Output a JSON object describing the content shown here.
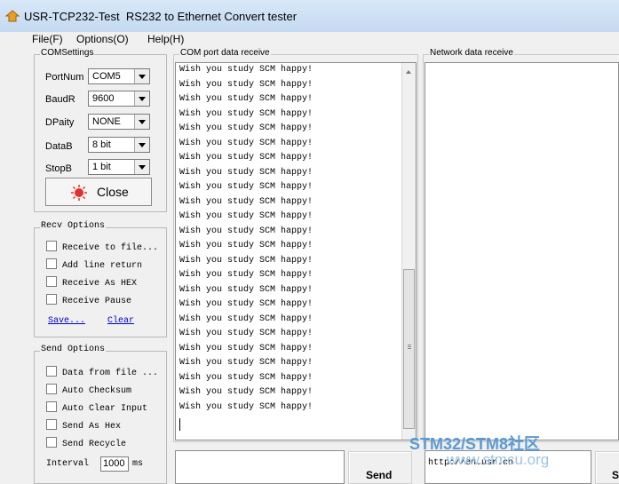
{
  "window": {
    "title": "USR-TCP232-Test  RS232 to Ethernet Convert tester"
  },
  "menu": {
    "items": [
      "File(F)",
      "Options(O)",
      "Help(H)"
    ]
  },
  "com_settings": {
    "legend": "COMSettings",
    "fields": [
      {
        "label": "PortNum",
        "value": "COM5"
      },
      {
        "label": "BaudR",
        "value": "9600"
      },
      {
        "label": "DPaity",
        "value": "NONE"
      },
      {
        "label": "DataB",
        "value": "8 bit"
      },
      {
        "label": "StopB",
        "value": "1 bit"
      }
    ],
    "close_label": "Close"
  },
  "recv_options": {
    "legend": "Recv Options",
    "checks": [
      "Receive to file...",
      "Add line return",
      "Receive As HEX",
      "Receive Pause"
    ],
    "save_label": "Save...",
    "clear_label": "Clear"
  },
  "send_options": {
    "legend": "Send Options",
    "checks": [
      "Data from file ...",
      "Auto Checksum",
      "Auto Clear Input",
      "Send As Hex",
      "Send Recycle"
    ],
    "interval_label": "Interval",
    "interval_value": "1000",
    "interval_unit": "ms"
  },
  "com_receive": {
    "legend": "COM port data receive",
    "lines": [
      "Wish you study SCM happy!",
      "Wish you study SCM happy!",
      "Wish you study SCM happy!",
      "Wish you study SCM happy!",
      "Wish you study SCM happy!",
      "Wish you study SCM happy!",
      "Wish you study SCM happy!",
      "Wish you study SCM happy!",
      "Wish you study SCM happy!",
      "Wish you study SCM happy!",
      "Wish you study SCM happy!",
      "Wish you study SCM happy!",
      "Wish you study SCM happy!",
      "Wish you study SCM happy!",
      "Wish you study SCM happy!",
      "Wish you study SCM happy!",
      "Wish you study SCM happy!",
      "Wish you study SCM happy!",
      "Wish you study SCM happy!",
      "Wish you study SCM happy!",
      "Wish you study SCM happy!",
      "Wish you study SCM happy!",
      "Wish you study SCM happy!",
      "Wish you study SCM happy!"
    ]
  },
  "network_receive": {
    "legend": "Network data receive"
  },
  "com_send": {
    "send_label": "Send"
  },
  "network_send": {
    "text": "http://en.usr.cn",
    "send_label": "S"
  },
  "watermark": {
    "line1": "STM32/STM8社区",
    "line2": "www.stmcu.org"
  },
  "colors": {
    "close_icon": "#e23030",
    "link": "#0000d0",
    "watermark": "#5b9bd5"
  }
}
